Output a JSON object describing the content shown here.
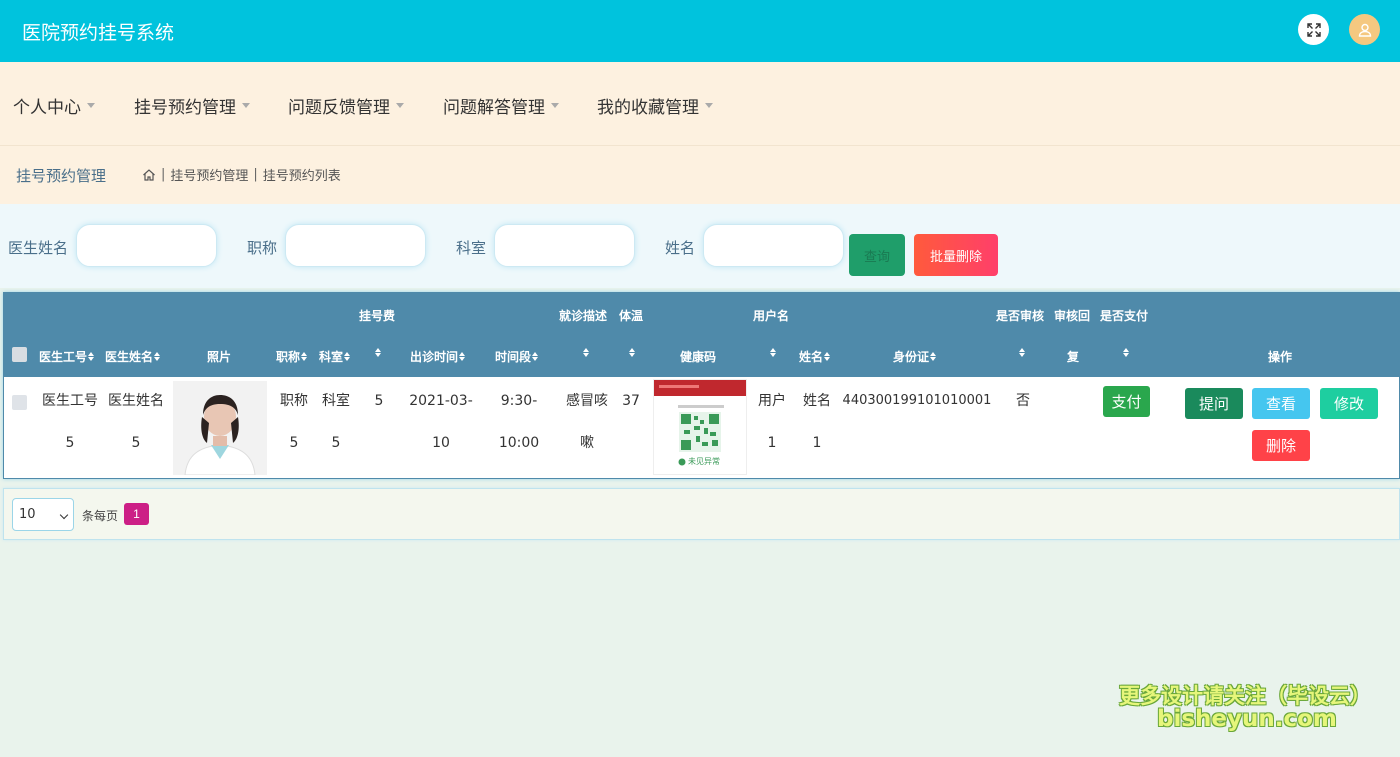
{
  "app": {
    "title": "医院预约挂号系统"
  },
  "nav": [
    {
      "label": "个人中心"
    },
    {
      "label": "挂号预约管理"
    },
    {
      "label": "问题反馈管理"
    },
    {
      "label": "问题解答管理"
    },
    {
      "label": "我的收藏管理"
    }
  ],
  "breadcrumb": {
    "title": "挂号预约管理",
    "items": [
      "挂号预约管理",
      "挂号预约列表"
    ]
  },
  "search": {
    "fields": [
      {
        "label": "医生姓名",
        "value": ""
      },
      {
        "label": "职称",
        "value": ""
      },
      {
        "label": "科室",
        "value": ""
      },
      {
        "label": "姓名",
        "value": ""
      }
    ],
    "search_button": "查询",
    "batch_delete_button": "批量删除"
  },
  "table": {
    "headers": {
      "doctor_no": "医生工号",
      "doctor_name": "医生姓名",
      "photo": "照片",
      "title": "职称",
      "dept": "科室",
      "fee": "挂号费",
      "visit_time": "出诊时间",
      "period": "时间段",
      "desc": "就诊描述",
      "temp": "体温",
      "health_code": "健康码",
      "username": "用户名",
      "name": "姓名",
      "id_card": "身份证",
      "audited": "是否审核",
      "reply_a": "审核回",
      "reply_b": "复",
      "paid": "是否支付",
      "ops": "操作"
    },
    "row": {
      "doctor_no_a": "医生工号",
      "doctor_no_b": "5",
      "doctor_name_a": "医生姓名",
      "doctor_name_b": "5",
      "title_a": "职称",
      "title_b": "5",
      "dept_a": "科室",
      "dept_b": "5",
      "fee": "5",
      "visit_time_a": "2021-03-",
      "visit_time_b": "10",
      "period_a": "9:30-",
      "period_b": "10:00",
      "desc_a": "感冒咳",
      "desc_b": "嗽",
      "temp": "37",
      "username_a": "用户",
      "username_b": "1",
      "name_a": "姓名",
      "name_b": "1",
      "id_card": "440300199101010001",
      "audited": "否",
      "pay_button": "支付",
      "ask_button": "提问",
      "view_button": "查看",
      "edit_button": "修改",
      "delete_button": "删除"
    },
    "health_code_status": "未见异常"
  },
  "pager": {
    "page_size": "10",
    "per_page_label": "条每页",
    "current_page": "1"
  },
  "watermark": {
    "line1": "更多设计请关注（毕设云）",
    "line2": "bisheyun.com"
  },
  "colors": {
    "topbar": "#00c3dd",
    "nav_bg": "#fdf1e0",
    "table_header": "#4f8aaa",
    "page_active": "#cc1f86"
  }
}
